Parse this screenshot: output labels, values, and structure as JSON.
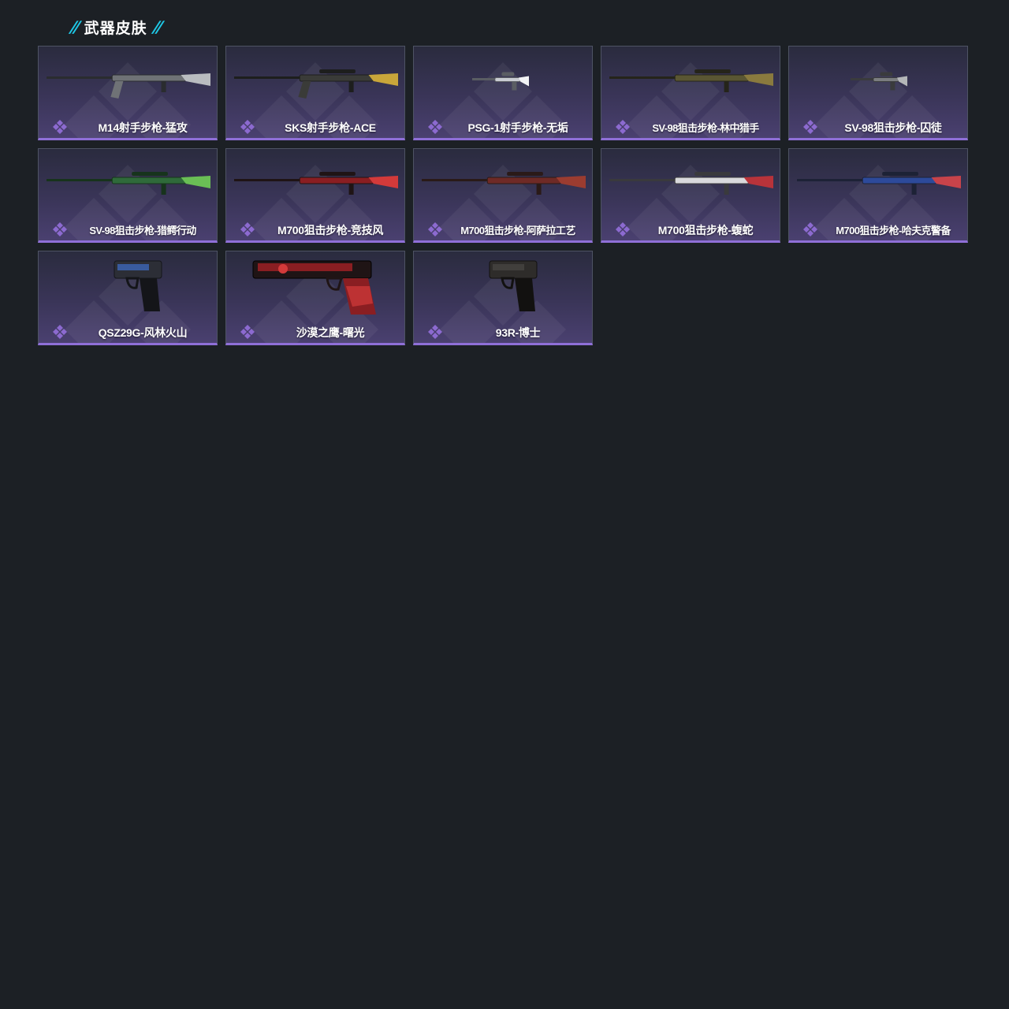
{
  "section": {
    "title": "武器皮肤",
    "slash_left": "//",
    "slash_right": "//"
  },
  "colors": {
    "background": "#1c2025",
    "accent_cyan": "#1ec8e6",
    "card_rarity_purple": "#8f6fd8",
    "rarity_icon": "#8c6ad0"
  },
  "cards": [
    {
      "name": "M14射手步枪-猛攻",
      "weapon": "marksman-rifle",
      "finish": "gray-camo",
      "icon": "rarity-diamond-icon"
    },
    {
      "name": "SKS射手步枪-ACE",
      "weapon": "sks-rifle",
      "finish": "black-gold",
      "icon": "rarity-diamond-icon"
    },
    {
      "name": "PSG-1射手步枪-无垢",
      "weapon": "psg1-rifle",
      "finish": "white",
      "icon": "rarity-diamond-icon"
    },
    {
      "name": "SV-98狙击步枪-林中猎手",
      "weapon": "sniper-rifle",
      "finish": "woodland-camo",
      "icon": "rarity-diamond-icon"
    },
    {
      "name": "SV-98狙击步枪-囚徒",
      "weapon": "sniper-rifle",
      "finish": "gray",
      "icon": "rarity-diamond-icon"
    },
    {
      "name": "SV-98狙击步枪-猎鳄行动",
      "weapon": "sniper-rifle",
      "finish": "green",
      "icon": "rarity-diamond-icon"
    },
    {
      "name": "M700狙击步枪-竞技风",
      "weapon": "m700-rifle",
      "finish": "red-black",
      "icon": "rarity-diamond-icon"
    },
    {
      "name": "M700狙击步枪-阿萨拉工艺",
      "weapon": "m700-rifle",
      "finish": "red-wood",
      "icon": "rarity-diamond-icon"
    },
    {
      "name": "M700狙击步枪-蝮蛇",
      "weapon": "m700-rifle",
      "finish": "white-red",
      "icon": "rarity-diamond-icon"
    },
    {
      "name": "M700狙击步枪-哈夫克警备",
      "weapon": "m700-rifle",
      "finish": "blue-red",
      "icon": "rarity-diamond-icon"
    },
    {
      "name": "QSZ29G-风林火山",
      "weapon": "pistol",
      "finish": "black-blue",
      "icon": "rarity-diamond-icon"
    },
    {
      "name": "沙漠之鹰-曙光",
      "weapon": "desert-eagle",
      "finish": "red-black",
      "icon": "rarity-diamond-icon"
    },
    {
      "name": "93R-博士",
      "weapon": "pistol",
      "finish": "black",
      "icon": "rarity-diamond-icon"
    }
  ]
}
